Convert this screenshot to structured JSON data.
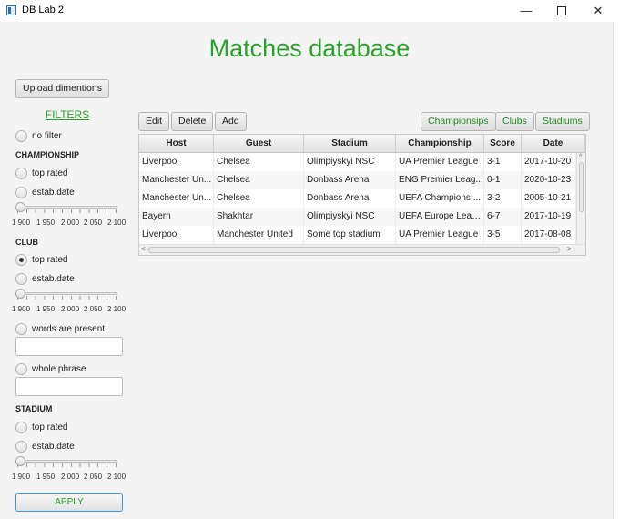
{
  "window": {
    "title": "DB Lab 2",
    "min_glyph": "—",
    "close_glyph": "✕"
  },
  "header": {
    "title": "Matches database"
  },
  "sidebar": {
    "upload_label": "Upload dimentions",
    "filters_title": "FILTERS",
    "no_filter": "no filter",
    "championship": {
      "label": "CHAMPIONSHIP",
      "top_rated": "top rated",
      "estab_date": "estab.date"
    },
    "club": {
      "label": "CLUB",
      "top_rated": "top rated",
      "estab_date": "estab.date",
      "selected": "top rated"
    },
    "words_present": "words are present",
    "whole_phrase": "whole phrase",
    "stadium": {
      "label": "STADIUM",
      "top_rated": "top rated",
      "estab_date": "estab.date"
    },
    "slider_ticks": [
      "1 900",
      "1 950",
      "2 000",
      "2 050",
      "2 100"
    ],
    "apply_label": "APPLY"
  },
  "toolbar": {
    "edit": "Edit",
    "delete": "Delete",
    "add": "Add",
    "championships": "Championsips",
    "clubs": "Clubs",
    "stadiums": "Stadiums"
  },
  "table": {
    "columns": [
      "Host",
      "Guest",
      "Stadium",
      "Championship",
      "Score",
      "Date"
    ],
    "rows": [
      [
        "Liverpool",
        "Chelsea",
        "Olimpiyskyi NSC",
        "UA Premier League",
        "3-1",
        "2017-10-20"
      ],
      [
        "Manchester Un...",
        "Chelsea",
        "Donbass Arena",
        "ENG Premier Leag...",
        "0-1",
        "2020-10-23"
      ],
      [
        "Manchester Un...",
        "Chelsea",
        "Donbass Arena",
        "UEFA Champions ...",
        "3-2",
        "2005-10-21"
      ],
      [
        "Bayern",
        "Shakhtar",
        "Olimpiyskyi NSC",
        "UEFA Europe Leag...",
        "6-7",
        "2017-10-19"
      ],
      [
        "Liverpool",
        "Manchester United",
        "Some top stadium",
        "UA Premier League",
        "3-5",
        "2017-08-08"
      ]
    ]
  }
}
